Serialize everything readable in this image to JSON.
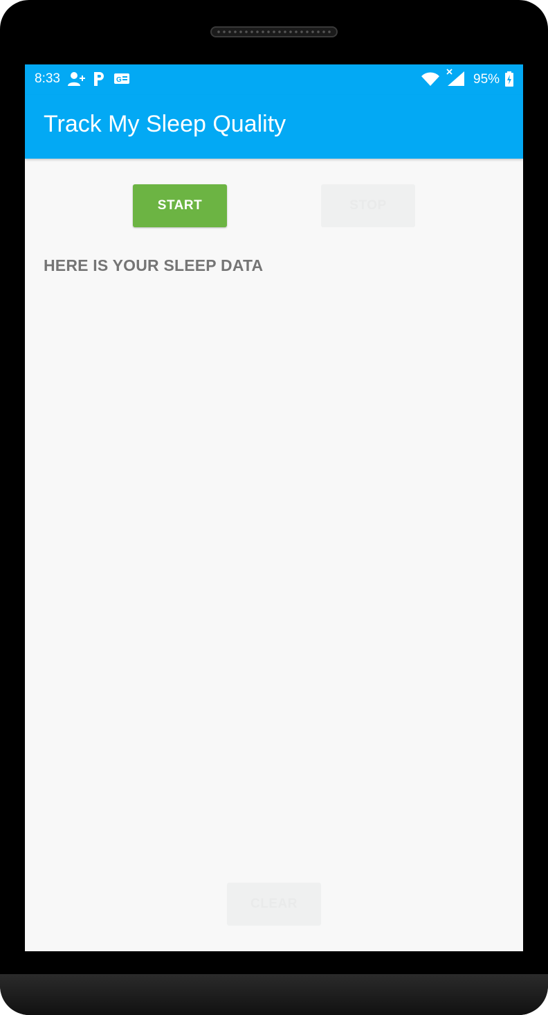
{
  "status_bar": {
    "time": "8:33",
    "battery": "95%",
    "icons": [
      "add-contact-icon",
      "parking-icon",
      "news-icon",
      "wifi-icon",
      "signal-icon",
      "battery-charging-icon"
    ],
    "background_color": "#03a9f4"
  },
  "app_bar": {
    "title": "Track My Sleep Quality",
    "background_color": "#03a9f4"
  },
  "buttons": {
    "start": {
      "label": "START",
      "color": "#6cb443",
      "enabled": true
    },
    "stop": {
      "label": "STOP",
      "enabled": false
    },
    "clear": {
      "label": "CLEAR",
      "enabled": false
    }
  },
  "main": {
    "sleep_data_text": "HERE IS YOUR SLEEP DATA"
  }
}
